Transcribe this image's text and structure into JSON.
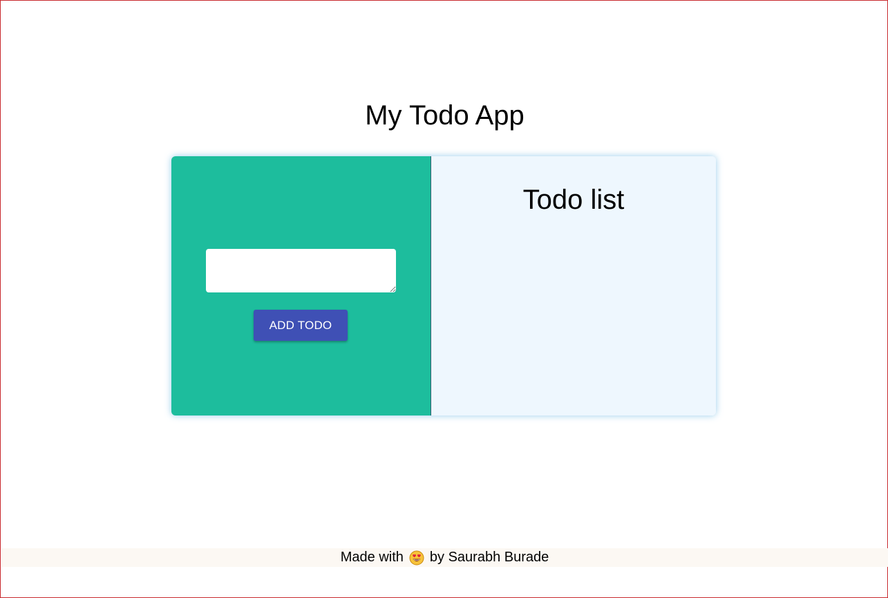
{
  "header": {
    "title": "My Todo App"
  },
  "add_panel": {
    "input_value": "",
    "input_placeholder": "",
    "button_label": "ADD TODO",
    "color": "#1dbd9d",
    "button_color": "#3f50b5"
  },
  "list_panel": {
    "title": "Todo list",
    "items": [],
    "color": "#eef7fe"
  },
  "footer": {
    "prefix": "Made with",
    "icon": "heart-eyes-emoji-icon",
    "suffix": "by Saurabh Burade"
  }
}
